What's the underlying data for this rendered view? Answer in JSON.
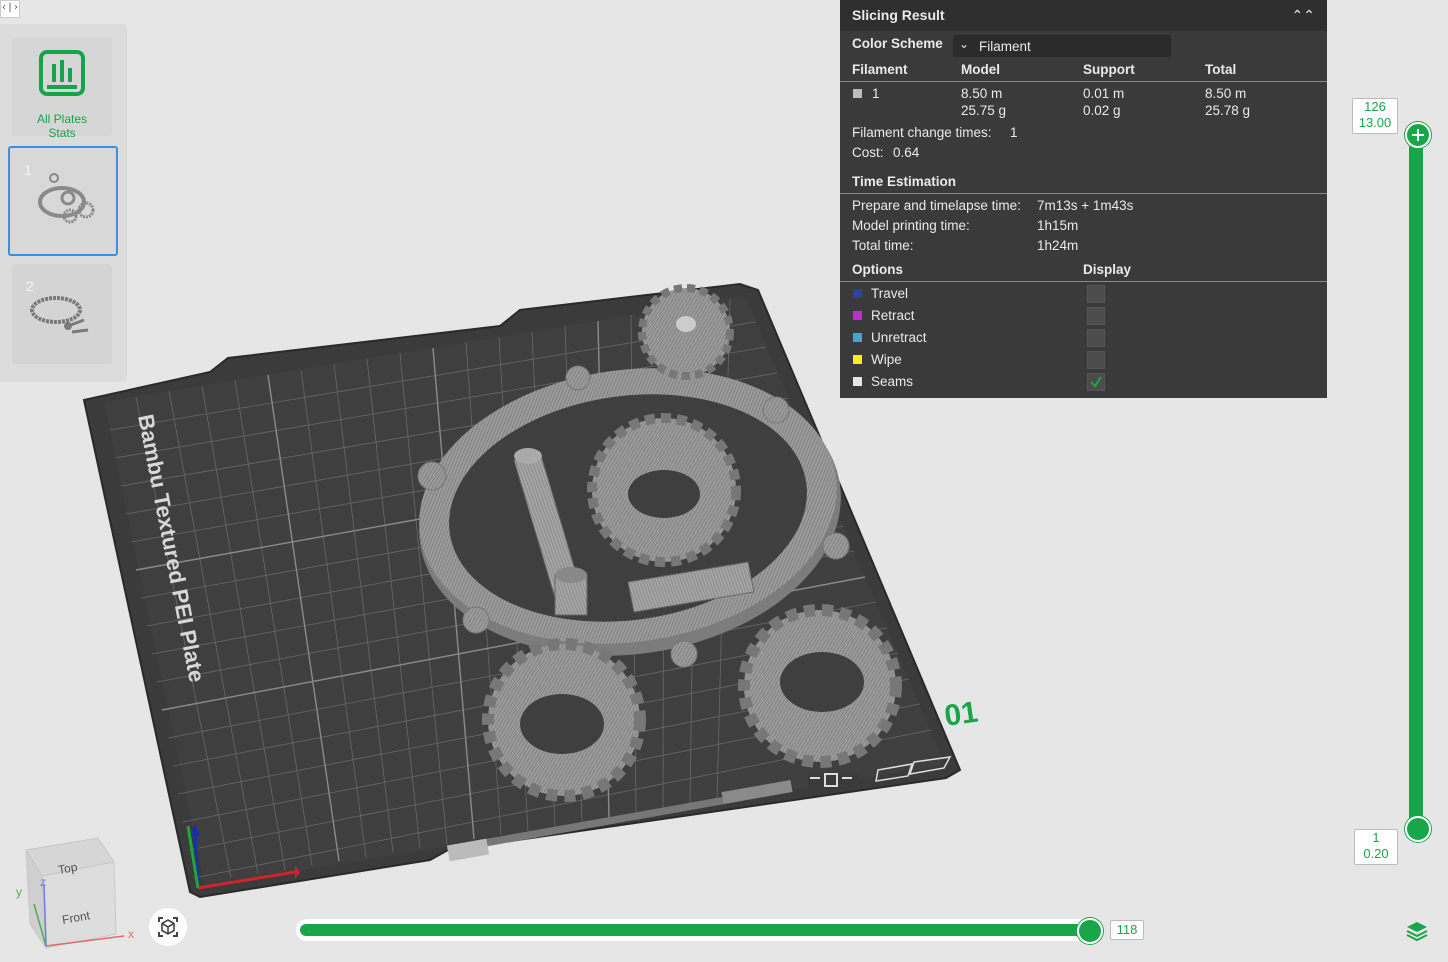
{
  "sidebar": {
    "stats_label_line1": "All Plates",
    "stats_label_line2": "Stats",
    "plates": [
      {
        "number": "1"
      },
      {
        "number": "2"
      }
    ]
  },
  "plate_label": "Bambu Textured PEI Plate",
  "plate_index": "01",
  "panel": {
    "title": "Slicing Result",
    "color_scheme_label": "Color Scheme",
    "color_scheme_value": "Filament",
    "columns": [
      "Filament",
      "Model",
      "Support",
      "Total"
    ],
    "filament_row": {
      "id": "1",
      "model_length": "8.50 m",
      "model_weight": "25.75 g",
      "support_length": "0.01 m",
      "support_weight": "0.02 g",
      "total_length": "8.50 m",
      "total_weight": "25.78 g"
    },
    "change_times_label": "Filament change times:",
    "change_times_value": "1",
    "cost_label": "Cost:",
    "cost_value": "0.64",
    "time_title": "Time Estimation",
    "prepare_label": "Prepare and timelapse time:",
    "prepare_value": "7m13s + 1m43s",
    "model_time_label": "Model printing time:",
    "model_time_value": "1h15m",
    "total_time_label": "Total time:",
    "total_time_value": "1h24m",
    "options_title": "Options",
    "display_title": "Display",
    "options": [
      {
        "label": "Travel",
        "color": "#2e3fa6",
        "checked": false
      },
      {
        "label": "Retract",
        "color": "#c12bd6",
        "checked": false
      },
      {
        "label": "Unretract",
        "color": "#3ea9c8",
        "checked": false
      },
      {
        "label": "Wipe",
        "color": "#f2ef19",
        "checked": false
      },
      {
        "label": "Seams",
        "color": "#e6e6e6",
        "checked": true
      }
    ]
  },
  "layer_slider": {
    "top_layer": "126",
    "top_height": "13.00",
    "bottom_layer": "1",
    "bottom_height": "0.20"
  },
  "move_slider": {
    "value": "118"
  },
  "view_cube": {
    "top": "Top",
    "front": "Front",
    "x": "x",
    "y": "y",
    "z": "z"
  },
  "accent_color": "#19a64a"
}
